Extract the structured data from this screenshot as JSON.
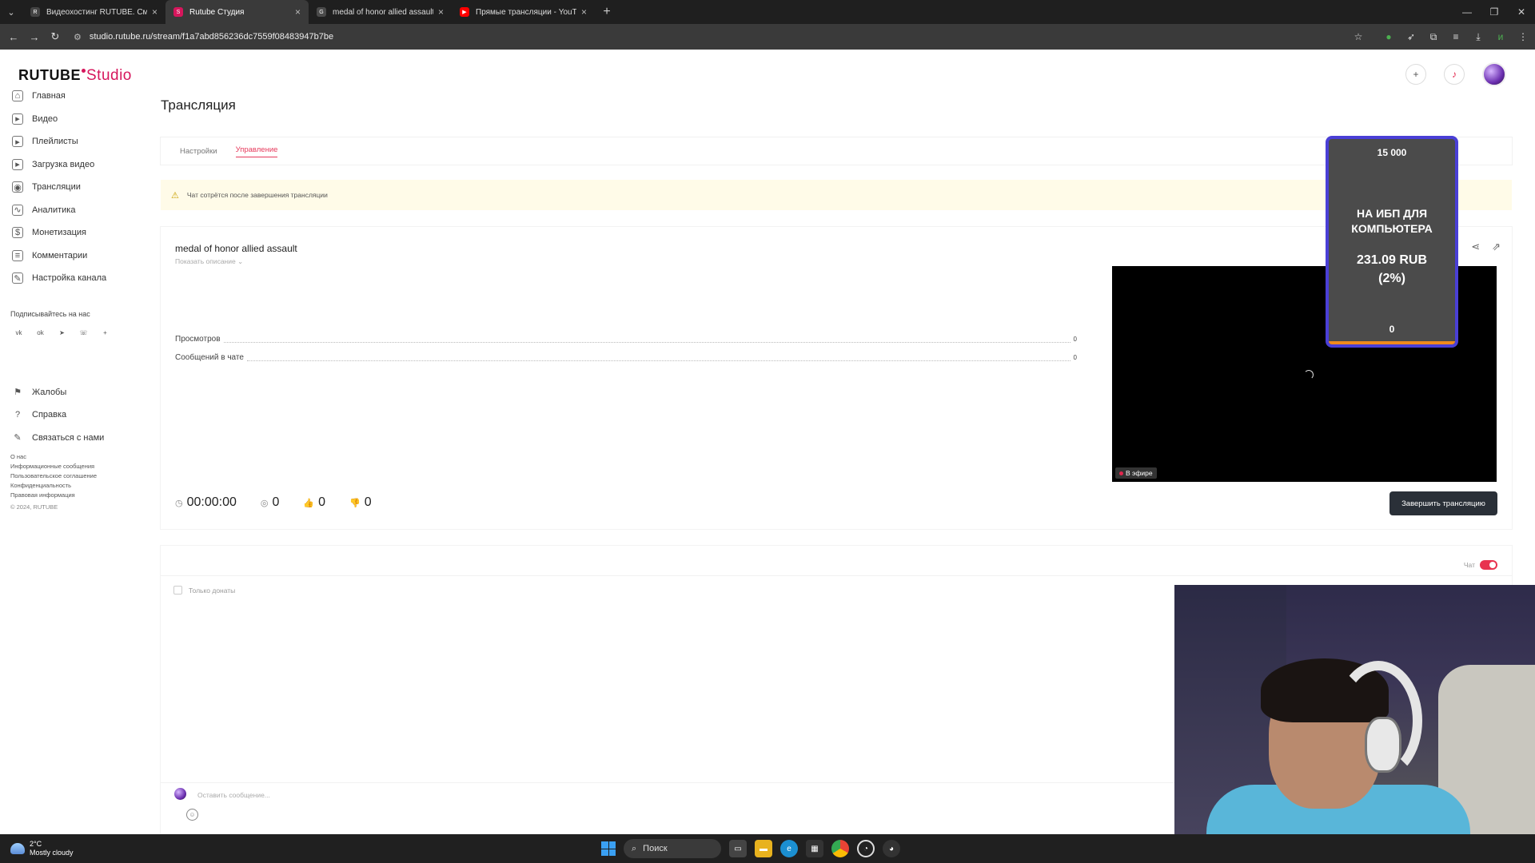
{
  "browser": {
    "tabs": [
      {
        "title": "Видеохостинг RUTUBE. Смотр",
        "favicon_color": "#444444",
        "favicon_glyph": "R",
        "active": false
      },
      {
        "title": "Rutube Студия",
        "favicon_color": "#d6165c",
        "favicon_glyph": "S",
        "active": true
      },
      {
        "title": "medal of honor allied assault",
        "favicon_color": "#4a4a4a",
        "favicon_glyph": "G",
        "active": false
      },
      {
        "title": "Прямые трансляции - YouTub",
        "favicon_color": "#ff0000",
        "favicon_glyph": "▶",
        "active": false
      }
    ],
    "url": "studio.rutube.ru/stream/f1a7abd856236dc7559f08483947b7be"
  },
  "app": {
    "logo_main": "RUTUBE",
    "logo_sub": "Studio",
    "page_title": "Трансляция",
    "sidebar": {
      "items": [
        {
          "label": "Главная",
          "icon": "home-icon",
          "glyph": "⌂"
        },
        {
          "label": "Видео",
          "icon": "video-icon",
          "glyph": "▸"
        },
        {
          "label": "Плейлисты",
          "icon": "playlist-icon",
          "glyph": "▸"
        },
        {
          "label": "Загрузка видео",
          "icon": "upload-icon",
          "glyph": "▸"
        },
        {
          "label": "Трансляции",
          "icon": "broadcast-icon",
          "glyph": "◉"
        },
        {
          "label": "Аналитика",
          "icon": "analytics-icon",
          "glyph": "∿"
        },
        {
          "label": "Монетизация",
          "icon": "money-icon",
          "glyph": "$"
        },
        {
          "label": "Комментарии",
          "icon": "comments-icon",
          "glyph": "≡"
        },
        {
          "label": "Настройка канала",
          "icon": "wand-icon",
          "glyph": "✎"
        }
      ],
      "subscribe_label": "Подписывайтесь на нас",
      "socials": [
        {
          "icon": "vk-icon",
          "glyph": "vk"
        },
        {
          "icon": "ok-icon",
          "glyph": "ok"
        },
        {
          "icon": "telegram-icon",
          "glyph": "➤"
        },
        {
          "icon": "viber-icon",
          "glyph": "☏"
        },
        {
          "icon": "plus-icon",
          "glyph": "+"
        }
      ],
      "support_items": [
        {
          "label": "Жалобы",
          "icon": "flag-icon",
          "glyph": "⚑"
        },
        {
          "label": "Справка",
          "icon": "help-icon",
          "glyph": "?"
        },
        {
          "label": "Связаться с нами",
          "icon": "pen-icon",
          "glyph": "✎"
        }
      ],
      "footer_links": [
        "О нас",
        "Информационные сообщения",
        "Пользовательское соглашение",
        "Конфиденциальность",
        "Правовая информация"
      ],
      "copyright": "© 2024, RUTUBE"
    },
    "tabs": [
      {
        "label": "Настройки",
        "active": false
      },
      {
        "label": "Управление",
        "active": true
      }
    ],
    "alert": "Чат сотрётся после завершения трансляции",
    "stream": {
      "title": "medal of honor allied assault",
      "show_description": "Показать описание",
      "stats": [
        {
          "label": "Просмотров",
          "value": "0"
        },
        {
          "label": "Сообщений в чате",
          "value": "0"
        }
      ],
      "counters": [
        {
          "icon": "clock-icon",
          "glyph": "◷",
          "value": "00:00:00"
        },
        {
          "icon": "viewers-icon",
          "glyph": "◎",
          "value": "0"
        },
        {
          "icon": "like-icon",
          "glyph": "👍",
          "value": "0"
        },
        {
          "icon": "dislike-icon",
          "glyph": "👎",
          "value": "0"
        }
      ],
      "live_badge": "В эфире",
      "end_button": "Завершить трансляцию"
    },
    "chat": {
      "toggle_label": "Чат",
      "toggle_on": true,
      "only_donations": "Только донаты",
      "input_placeholder": "Оставить сообщение..."
    }
  },
  "donation_widget": {
    "goal": "15 000",
    "title": "НА ИБП ДЛЯ КОМПЬЮТЕРА",
    "amount": "231.09 RUB",
    "percent": "(2%)",
    "current": "0",
    "progress_fraction": 0.02
  },
  "taskbar": {
    "temperature": "2°C",
    "weather": "Mostly cloudy",
    "search": "Поиск"
  },
  "colors": {
    "accent": "#d6165c",
    "live_red": "#e2264d",
    "widget_border": "#4a3fd6",
    "widget_bar": "#f08a1c"
  }
}
